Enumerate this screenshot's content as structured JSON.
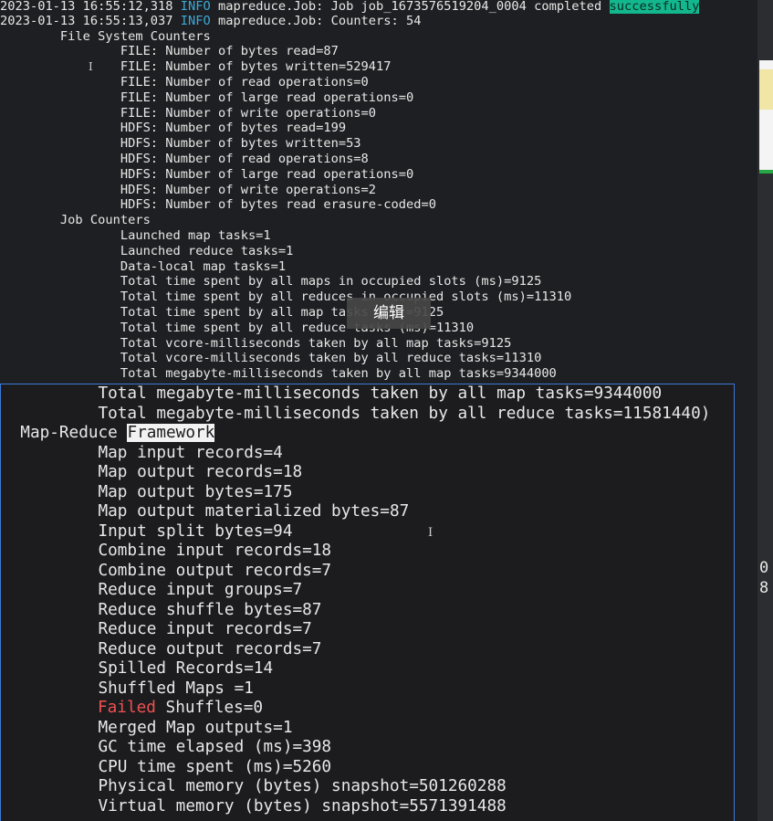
{
  "top_terminal": {
    "lines": [
      {
        "pre": "2023-01-13 16:55:12,318 ",
        "level": "INFO",
        "post": " mapreduce.Job: Job job_1673576519204_0004 completed ",
        "status": "successfully"
      },
      {
        "pre": "2023-01-13 16:55:13,037 ",
        "level": "INFO",
        "post": " mapreduce.Job: Counters: 54"
      },
      {
        "text": "        File System Counters"
      },
      {
        "text": "                FILE: Number of bytes read=87"
      },
      {
        "text": "                FILE: Number of bytes written=529417"
      },
      {
        "text": "                FILE: Number of read operations=0"
      },
      {
        "text": "                FILE: Number of large read operations=0"
      },
      {
        "text": "                FILE: Number of write operations=0"
      },
      {
        "text": "                HDFS: Number of bytes read=199"
      },
      {
        "text": "                HDFS: Number of bytes written=53"
      },
      {
        "text": "                HDFS: Number of read operations=8"
      },
      {
        "text": "                HDFS: Number of large read operations=0"
      },
      {
        "text": "                HDFS: Number of write operations=2"
      },
      {
        "text": "                HDFS: Number of bytes read erasure-coded=0"
      },
      {
        "text": "        Job Counters"
      },
      {
        "text": "                Launched map tasks=1"
      },
      {
        "text": "                Launched reduce tasks=1"
      },
      {
        "text": "                Data-local map tasks=1"
      },
      {
        "text": "                Total time spent by all maps in occupied slots (ms)=9125"
      },
      {
        "text": "                Total time spent by all reduces in occupied slots (ms)=11310"
      },
      {
        "text": "                Total time spent by all map tasks (ms)=9125"
      },
      {
        "text": "                Total time spent by all reduce tasks (ms)=11310"
      },
      {
        "text": "                Total vcore-milliseconds taken by all map tasks=9125"
      },
      {
        "text": "                Total vcore-milliseconds taken by all reduce tasks=11310"
      },
      {
        "text": "                Total megabyte-milliseconds taken by all map tasks=9344000"
      }
    ]
  },
  "tooltip": {
    "label": "编辑"
  },
  "zoom_terminal": {
    "lines": [
      {
        "text": "          Total megabyte-milliseconds taken by all map tasks=9344000"
      },
      {
        "text": "          Total megabyte-milliseconds taken by all reduce tasks=11581440)"
      },
      {
        "pre": "  Map-Reduce ",
        "highlight": "Framework"
      },
      {
        "text": "          Map input records=4"
      },
      {
        "text": "          Map output records=18"
      },
      {
        "text": "          Map output bytes=175"
      },
      {
        "text": "          Map output materialized bytes=87"
      },
      {
        "text": "          Input split bytes=94"
      },
      {
        "text": "          Combine input records=18"
      },
      {
        "text": "          Combine output records=7"
      },
      {
        "text": "          Reduce input groups=7"
      },
      {
        "text": "          Reduce shuffle bytes=87"
      },
      {
        "text": "          Reduce input records=7"
      },
      {
        "text": "          Reduce output records=7"
      },
      {
        "text": "          Spilled Records=14"
      },
      {
        "text": "          Shuffled Maps =1"
      },
      {
        "failed": "Failed",
        "post": " Shuffles=0"
      },
      {
        "text": "          Merged Map outputs=1"
      },
      {
        "text": "          GC time elapsed (ms)=398"
      },
      {
        "text": "          CPU time spent (ms)=5260"
      },
      {
        "text": "          Physical memory (bytes) snapshot=501260288"
      },
      {
        "text": "          Virtual memory (bytes) snapshot=5571391488"
      }
    ]
  },
  "side_digits": [
    "0",
    "8"
  ],
  "text_cursor": "I",
  "colors": {
    "info": "#3da9d6",
    "success_bg": "#13b78e",
    "failed": "#ef5150",
    "zoom_border": "#3c79d6"
  }
}
